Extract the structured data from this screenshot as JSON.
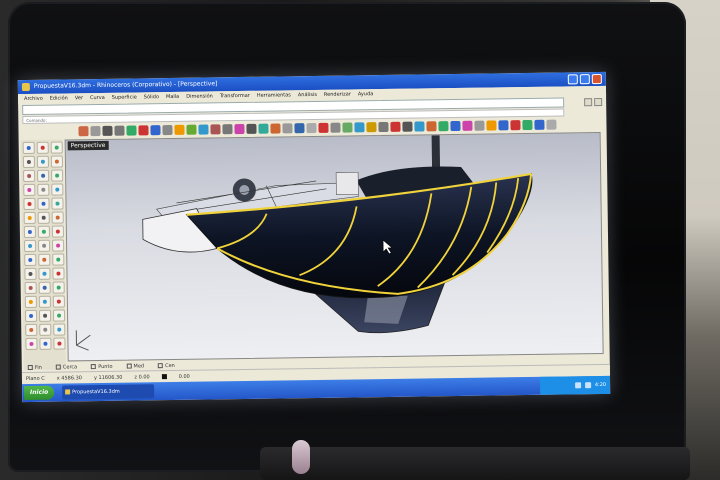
{
  "window": {
    "title": "PropuestaV16.3dm - Rhinoceros (Corporativo) - [Perspective]",
    "buttons": [
      "minimize",
      "maximize",
      "close"
    ]
  },
  "menu": [
    "Archivo",
    "Edición",
    "Ver",
    "Curva",
    "Superficie",
    "Sólido",
    "Malla",
    "Dimensión",
    "Transformar",
    "Herramientas",
    "Análisis",
    "Renderizar",
    "Ayuda"
  ],
  "command": {
    "line": "",
    "prompt": "Comando:"
  },
  "viewport": {
    "label": "Perspective"
  },
  "osnap": [
    "Fin",
    "Cerca",
    "Punto",
    "Med",
    "Cen"
  ],
  "status": {
    "cplane": "Plano C",
    "x": "x 4586.30",
    "y": "y 11606.30",
    "z": "z 0.00",
    "units": "0.00"
  },
  "taskbar": {
    "start_label": "Inicio",
    "task_label": "PropuestaV16.3dm",
    "clock": "4:20"
  },
  "colors": {
    "hull": "#0d1424",
    "highlight": "#f0d23a",
    "titlebar": "#1b4fc4",
    "taskbar": "#2456c8"
  }
}
